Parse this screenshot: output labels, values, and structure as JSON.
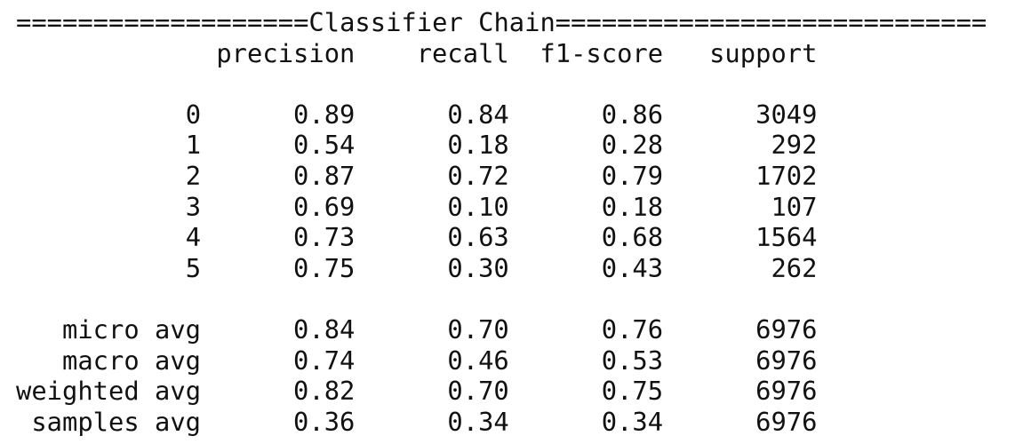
{
  "report": {
    "title_rule": "===================Classifier Chain============================",
    "columns": [
      "precision",
      "recall",
      "f1-score",
      "support"
    ],
    "class_rows": [
      {
        "label": "0",
        "precision": "0.89",
        "recall": "0.84",
        "f1": "0.86",
        "support": "3049"
      },
      {
        "label": "1",
        "precision": "0.54",
        "recall": "0.18",
        "f1": "0.28",
        "support": "292"
      },
      {
        "label": "2",
        "precision": "0.87",
        "recall": "0.72",
        "f1": "0.79",
        "support": "1702"
      },
      {
        "label": "3",
        "precision": "0.69",
        "recall": "0.10",
        "f1": "0.18",
        "support": "107"
      },
      {
        "label": "4",
        "precision": "0.73",
        "recall": "0.63",
        "f1": "0.68",
        "support": "1564"
      },
      {
        "label": "5",
        "precision": "0.75",
        "recall": "0.30",
        "f1": "0.43",
        "support": "262"
      }
    ],
    "avg_rows": [
      {
        "label": "micro avg",
        "precision": "0.84",
        "recall": "0.70",
        "f1": "0.76",
        "support": "6976"
      },
      {
        "label": "macro avg",
        "precision": "0.74",
        "recall": "0.46",
        "f1": "0.53",
        "support": "6976"
      },
      {
        "label": "weighted avg",
        "precision": "0.82",
        "recall": "0.70",
        "f1": "0.75",
        "support": "6976"
      },
      {
        "label": "samples avg",
        "precision": "0.36",
        "recall": "0.34",
        "f1": "0.34",
        "support": "6976"
      }
    ]
  }
}
